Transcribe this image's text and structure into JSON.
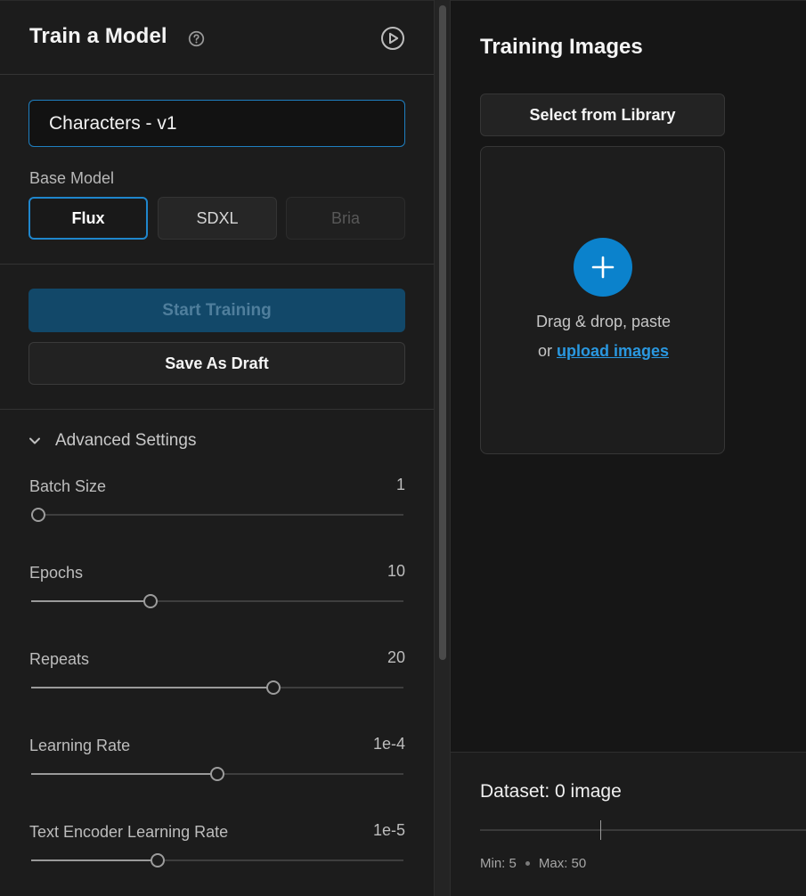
{
  "header": {
    "title": "Train a Model"
  },
  "form": {
    "model_name_value": "Characters - v1",
    "base_model_label": "Base Model",
    "base_models": [
      {
        "label": "Flux",
        "state": "selected"
      },
      {
        "label": "SDXL",
        "state": "default"
      },
      {
        "label": "Bria",
        "state": "disabled"
      }
    ],
    "start_training_label": "Start Training",
    "save_draft_label": "Save As Draft"
  },
  "advanced": {
    "label": "Advanced Settings",
    "expanded": true,
    "sliders": [
      {
        "name": "batch-size",
        "label": "Batch Size",
        "value": "1",
        "level": 0.02
      },
      {
        "name": "epochs",
        "label": "Epochs",
        "value": "10",
        "level": 0.32
      },
      {
        "name": "repeats",
        "label": "Repeats",
        "value": "20",
        "level": 0.65
      },
      {
        "name": "learning-rate",
        "label": "Learning Rate",
        "value": "1e-4",
        "level": 0.5
      },
      {
        "name": "text-encoder-learning-rate",
        "label": "Text Encoder Learning Rate",
        "value": "1e-5",
        "level": 0.34
      }
    ]
  },
  "training_images": {
    "title": "Training Images",
    "library_button_label": "Select from Library",
    "drop_text_line1": "Drag & drop, paste",
    "drop_text_prefix": "or",
    "upload_link_label": "upload images"
  },
  "dataset": {
    "title": "Dataset: 0 image",
    "min_label": "Min: 5",
    "max_label": "Max: 50",
    "level": 0.37
  },
  "colors": {
    "accent": "#0b82cc",
    "selected_border": "#1f86cc",
    "start_button_bg": "#124869",
    "link": "#2a98e0"
  },
  "icons": {
    "help": "question-circle-icon",
    "play": "play-circle-icon",
    "chevron": "chevron-down-icon",
    "plus": "plus-icon"
  }
}
